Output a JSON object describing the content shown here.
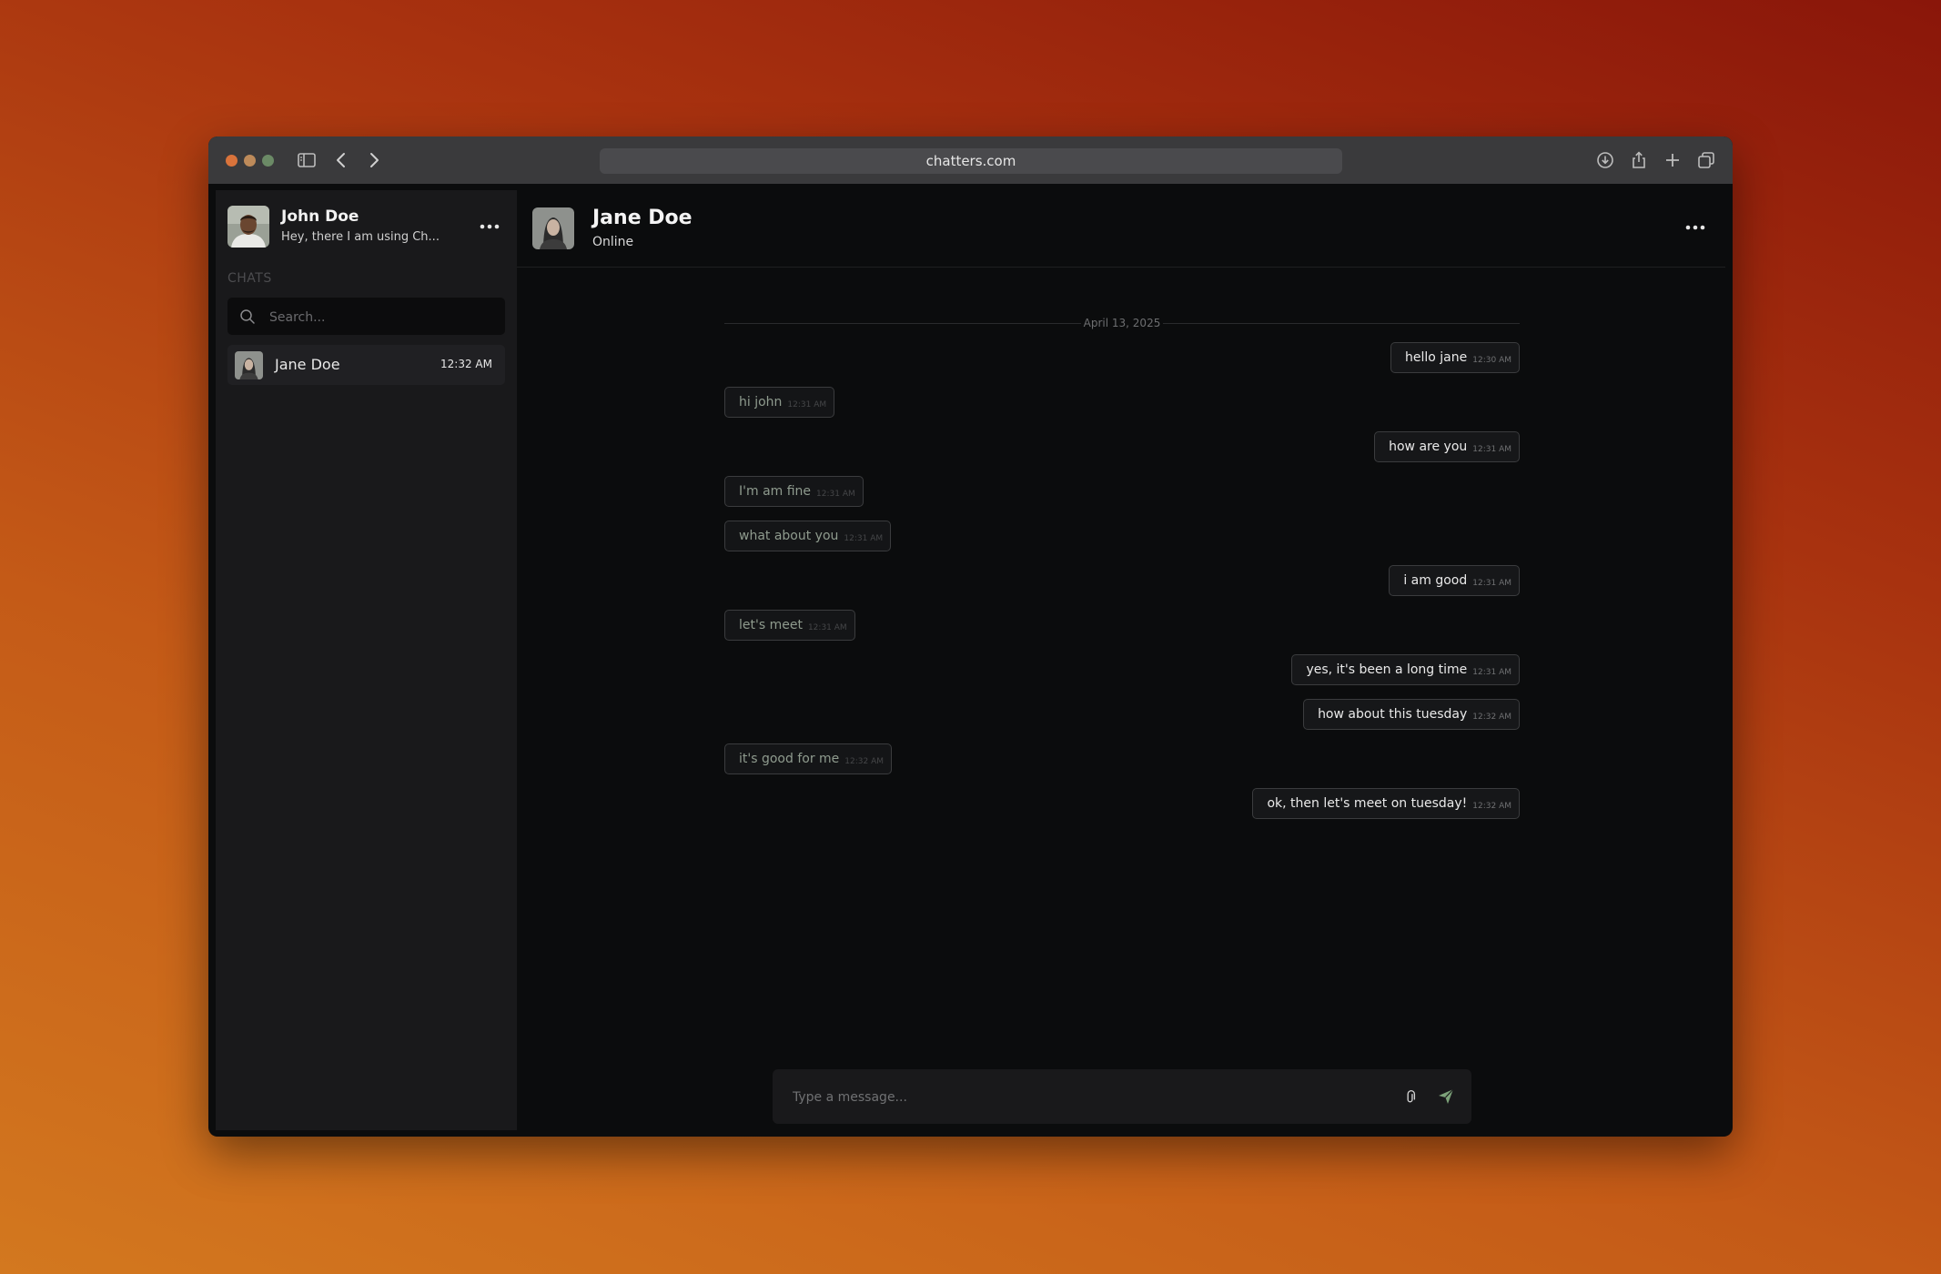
{
  "browser": {
    "url": "chatters.com"
  },
  "sidebar": {
    "user": {
      "name": "John Doe",
      "status": "Hey, there I am using Ch..."
    },
    "section_label": "CHATS",
    "search": {
      "placeholder": "Search..."
    },
    "chats": [
      {
        "name": "Jane Doe",
        "time": "12:32 AM"
      }
    ]
  },
  "conversation": {
    "partner": {
      "name": "Jane Doe",
      "status": "Online"
    },
    "date": "April 13, 2025",
    "messages": [
      {
        "direction": "out",
        "text": "hello jane",
        "time": "12:30 AM"
      },
      {
        "direction": "in",
        "text": "hi john",
        "time": "12:31 AM"
      },
      {
        "direction": "out",
        "text": "how are you",
        "time": "12:31 AM"
      },
      {
        "direction": "in",
        "text": "I'm am fine",
        "time": "12:31 AM"
      },
      {
        "direction": "in",
        "text": "what about you",
        "time": "12:31 AM"
      },
      {
        "direction": "out",
        "text": "i am good",
        "time": "12:31 AM"
      },
      {
        "direction": "in",
        "text": "let's meet",
        "time": "12:31 AM"
      },
      {
        "direction": "out",
        "text": "yes, it's been a long time",
        "time": "12:31 AM"
      },
      {
        "direction": "out",
        "text": "how about this tuesday",
        "time": "12:32 AM"
      },
      {
        "direction": "in",
        "text": "it's good for me",
        "time": "12:32 AM"
      },
      {
        "direction": "out",
        "text": "ok, then let's meet on tuesday!",
        "time": "12:32 AM"
      }
    ],
    "composer": {
      "placeholder": "Type a message..."
    }
  },
  "colors": {
    "send_accent": "#7da37a",
    "incoming_text": "#8f9b8e",
    "window_close": "#d9733b"
  },
  "icons": {
    "toolbar_left": [
      "sidebar-toggle-icon",
      "back-chevron-icon",
      "forward-chevron-icon"
    ],
    "toolbar_right": [
      "download-icon",
      "share-icon",
      "new-tab-icon",
      "tabs-overview-icon"
    ],
    "composer": [
      "attach-icon",
      "send-icon"
    ]
  }
}
